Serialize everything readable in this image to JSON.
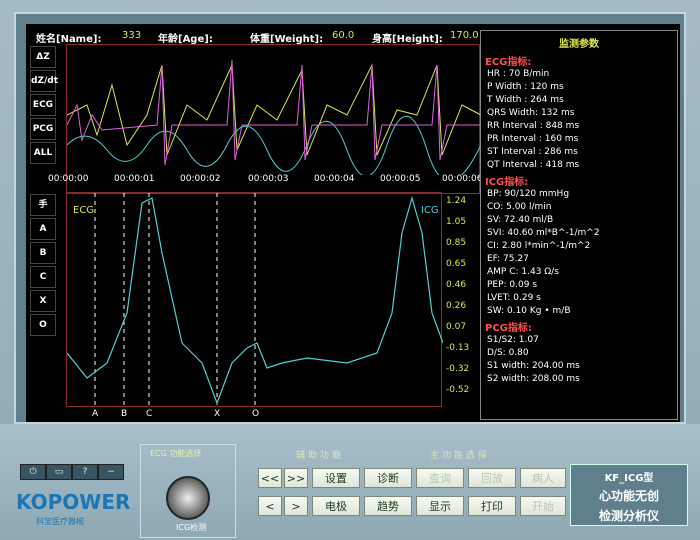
{
  "header": {
    "name_label": "姓名[Name]:",
    "age_label": "年龄[Age]:",
    "age_value": "333",
    "weight_label": "体重[Weight]:",
    "weight_value": "60.0",
    "height_label": "身高[Height]:",
    "height_value": "170.0"
  },
  "wave_buttons": [
    "ΔZ",
    "dZ/dt",
    "ECG",
    "PCG",
    "ALL"
  ],
  "marker_buttons": [
    "手",
    "A",
    "B",
    "C",
    "X",
    "O"
  ],
  "time_ticks": [
    "00:00:00",
    "00:00:01",
    "00:00:02",
    "00:00:03",
    "00:00:04",
    "00:00:05",
    "00:00:06"
  ],
  "icg_chart": {
    "ecg_label": "ECG",
    "icg_label": "ICG",
    "y_ticks": [
      "1.24",
      "1.05",
      "0.85",
      "0.65",
      "0.46",
      "0.26",
      "0.07",
      "-0.13",
      "-0.32",
      "-0.52"
    ],
    "markers": [
      "A",
      "B",
      "C",
      "X",
      "O"
    ]
  },
  "monitor": {
    "title": "监测参数",
    "ecg_title": "ECG指标:",
    "ecg_rows": [
      "HR : 70 B/min",
      "P Width : 120 ms",
      "T Width : 264 ms",
      "QRS Width: 132 ms",
      "RR Interval : 848 ms",
      "PR Interval : 160 ms",
      "ST Interval : 286 ms",
      "QT Interval : 418 ms"
    ],
    "icg_title": "ICG指标:",
    "icg_rows": [
      "BP: 90/120 mmHg",
      "CO: 5.00 l/min",
      "SV: 72.40 ml/B",
      "SVI: 40.60 ml*B^-1/m^2",
      "CI: 2.80 l*min^-1/m^2",
      "EF: 75.27",
      "AMP C: 1.43 Ω/s",
      "PEP: 0.09 s",
      "LVET: 0.29 s",
      "SW: 0.10 Kg • m/B"
    ],
    "pcg_title": "PCG指标:",
    "pcg_rows": [
      "S1/S2: 1.07",
      "D/S: 0.80",
      "S1 width: 204.00 ms",
      "S2 width: 208.00 ms"
    ]
  },
  "bottom": {
    "knob_title": "ECG 功能选择",
    "knob_label": "ICG检测",
    "aux_title": "辅助功能",
    "main_title": "主功能选择",
    "btn_prev": "<<",
    "btn_next": ">>",
    "btn_left": "<",
    "btn_right": ">",
    "btn_setup": "设置",
    "btn_diag": "诊断",
    "btn_query": "查询",
    "btn_review": "回放",
    "btn_patient": "病人",
    "btn_electrode": "电极",
    "btn_trend": "趋势",
    "btn_display": "显示",
    "btn_print": "打印",
    "btn_start": "开始",
    "logo": "KOPOWER",
    "logo_sub": "科宝医疗器械",
    "brand_line1": "KF_ICG型",
    "brand_line2": "心功能无创",
    "brand_line3": "检测分析仪"
  },
  "colors": {
    "ecg": "#d8e84a",
    "icg": "#4fd0d0",
    "pcg": "#e060e0",
    "red": "#ff5050"
  }
}
